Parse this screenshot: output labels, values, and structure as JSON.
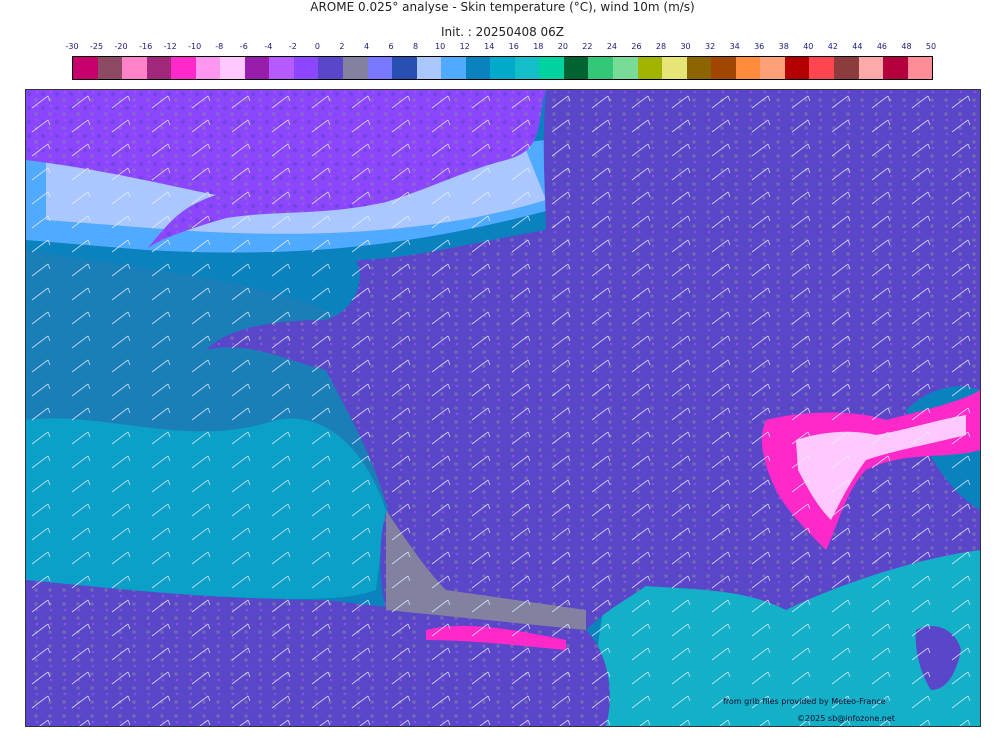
{
  "header": {
    "title": "AROME 0.025° analyse - Skin temperature (°C), wind 10m (m/s)",
    "init": "Init. : 20250408 06Z"
  },
  "legend": {
    "labels": [
      "-30",
      "-25",
      "-20",
      "-16",
      "-12",
      "-10",
      "-8",
      "-6",
      "-4",
      "-2",
      "0",
      "2",
      "4",
      "6",
      "8",
      "10",
      "12",
      "14",
      "16",
      "18",
      "20",
      "22",
      "24",
      "26",
      "28",
      "30",
      "32",
      "34",
      "36",
      "38",
      "40",
      "42",
      "44",
      "46",
      "48",
      "50"
    ],
    "colors": [
      "#c8006e",
      "#8c4a64",
      "#ff82c8",
      "#a0287a",
      "#ff28c8",
      "#ff96f0",
      "#ffc8ff",
      "#961eaa",
      "#b45aff",
      "#8c46ff",
      "#5a46c8",
      "#8282a0",
      "#7878ff",
      "#2850b4",
      "#aac8ff",
      "#50aaff",
      "#0a82be",
      "#00aac8",
      "#14bec8",
      "#00d2a0",
      "#006432",
      "#32c878",
      "#78dc96",
      "#a0b400",
      "#e6e678",
      "#8c6400",
      "#a04600",
      "#ff8c3c",
      "#ffa078",
      "#b40000",
      "#ff4650",
      "#8c3c3c",
      "#ffaaaa",
      "#b4003c",
      "#ff8c96"
    ]
  },
  "credits": {
    "source": "from grib files provided by Meteo-France",
    "copyright": "©2025 sb@infozone.net"
  }
}
